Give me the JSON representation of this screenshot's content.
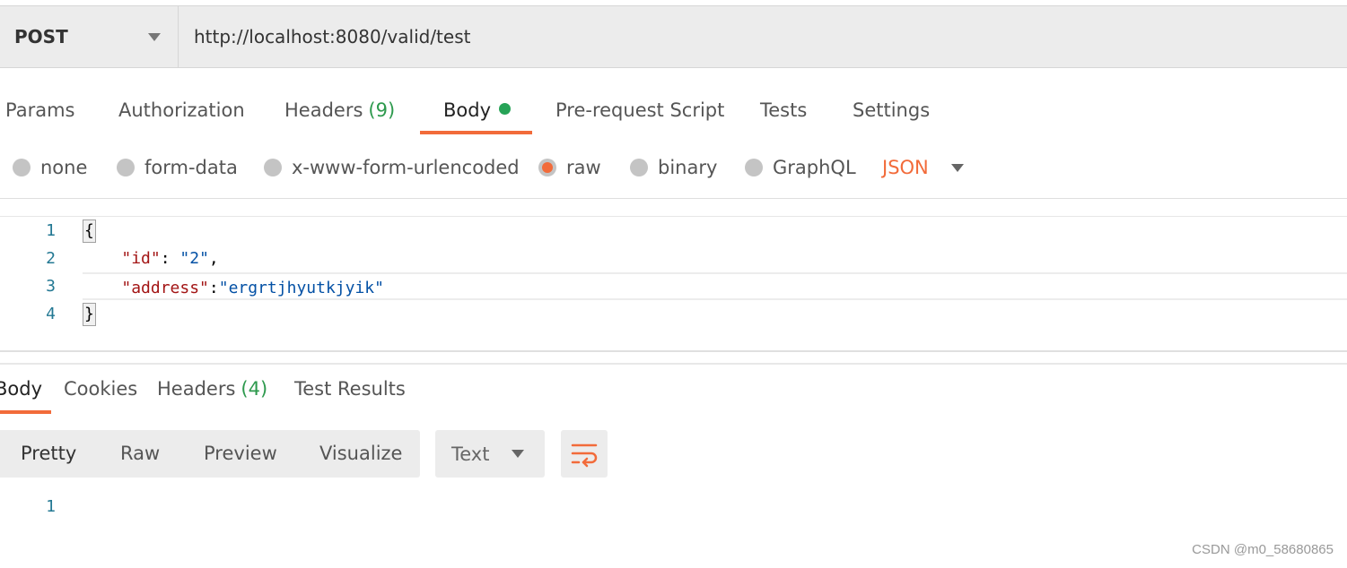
{
  "request": {
    "method": "POST",
    "url": "http://localhost:8080/valid/test"
  },
  "tabs": [
    {
      "label": "Params"
    },
    {
      "label": "Authorization"
    },
    {
      "label": "Headers",
      "count": "(9)"
    },
    {
      "label": "Body",
      "active": true
    },
    {
      "label": "Pre-request Script"
    },
    {
      "label": "Tests"
    },
    {
      "label": "Settings"
    }
  ],
  "body_types": {
    "options": [
      "none",
      "form-data",
      "x-www-form-urlencoded",
      "raw",
      "binary",
      "GraphQL"
    ],
    "selected": "raw",
    "format": "JSON"
  },
  "editor": {
    "line_numbers": [
      "1",
      "2",
      "3",
      "4"
    ],
    "open_brace": "{",
    "close_brace": "}",
    "id_key": "\"id\"",
    "id_value": "\"2\"",
    "address_key": "\"address\"",
    "address_value": "\"ergrtjhyutkjyik\""
  },
  "response": {
    "tabs": [
      {
        "label": "Body",
        "active": true
      },
      {
        "label": "Cookies"
      },
      {
        "label": "Headers",
        "count": "(4)"
      },
      {
        "label": "Test Results"
      }
    ],
    "views": [
      "Pretty",
      "Raw",
      "Preview",
      "Visualize"
    ],
    "view_selected": "Pretty",
    "format": "Text",
    "line_numbers": [
      "1"
    ]
  },
  "watermark": "CSDN @m0_58680865",
  "colors": {
    "accent": "#f26b3a",
    "success": "#26a357",
    "json_key": "#a31515",
    "json_value": "#0451a5",
    "line_number": "#237893"
  },
  "icons": {
    "method_dropdown": "chevron-down-icon",
    "format_dropdown": "chevron-down-icon",
    "wrap": "wrap-lines-icon"
  }
}
